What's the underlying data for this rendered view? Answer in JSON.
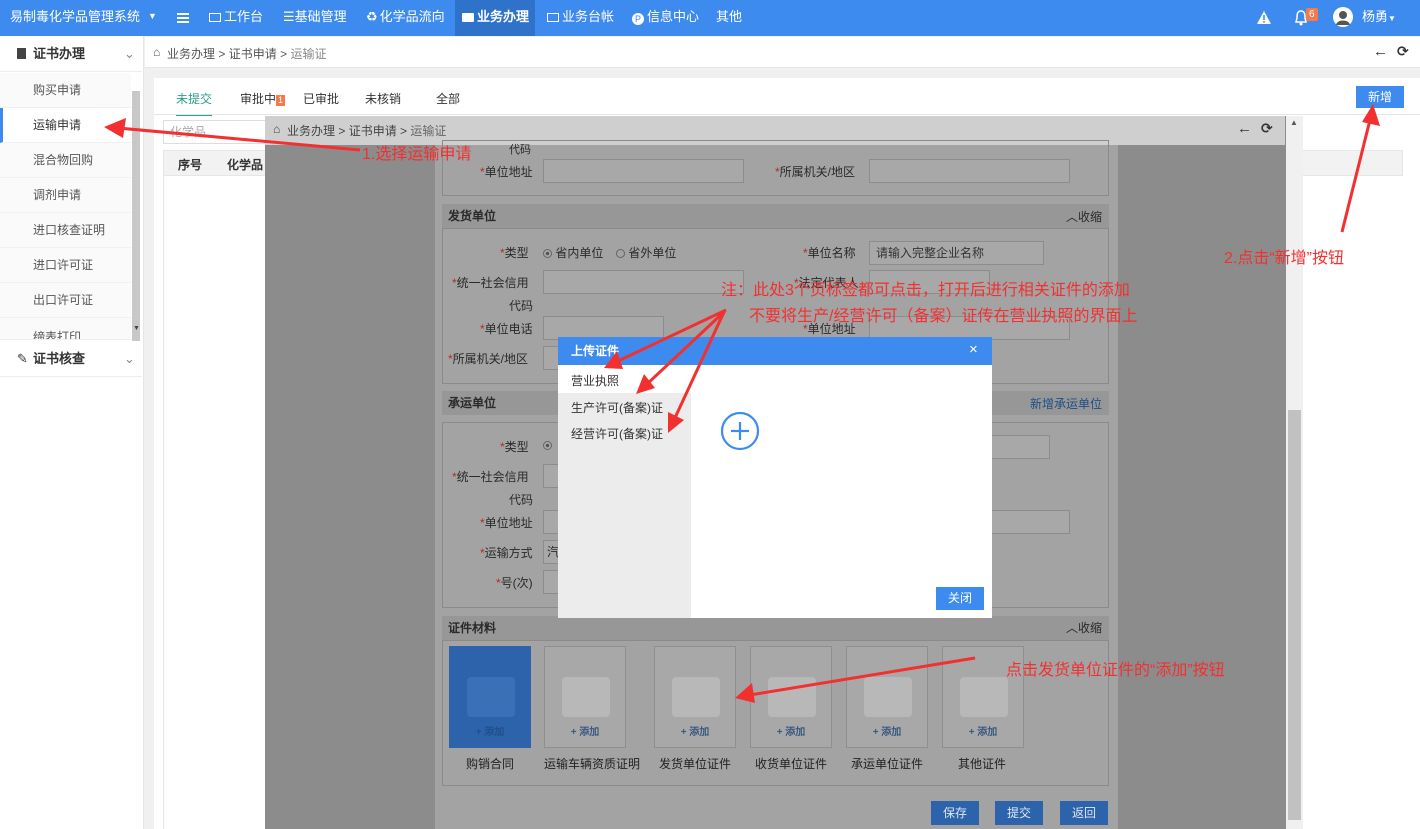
{
  "topbar": {
    "app_title": "易制毒化学品管理系统",
    "nav": [
      "工作台",
      "基础管理",
      "化学品流向",
      "业务办理",
      "业务台帐",
      "信息中心",
      "其他"
    ],
    "active_nav": "业务办理",
    "notif_count": "6",
    "user": "杨勇"
  },
  "sidebar": {
    "sections": [
      {
        "label": "证书办理"
      },
      {
        "label": "证书核查"
      }
    ],
    "items": [
      "购买申请",
      "运输申请",
      "混合物回购",
      "调剂申请",
      "进口核查证明",
      "进口许可证",
      "出口许可证",
      "缔表打印"
    ],
    "active_item": "运输申请"
  },
  "breadcrumb": {
    "home": "业务办理",
    "sep": ">",
    "b2": "证书申请",
    "b3": "运输证"
  },
  "tabs": [
    "未提交",
    "审批中",
    "已审批",
    "未核销",
    "全部"
  ],
  "tab_badge": "1",
  "new_button": "新增",
  "search": {
    "placeholder": "化学品"
  },
  "table": {
    "headers": [
      "序号",
      "化学品"
    ]
  },
  "overlay": {
    "breadcrumb": {
      "home": "业务办理",
      "b2": "证书申请",
      "b3": "运输证"
    },
    "top": {
      "code_tail": "代码",
      "address_label": "单位地址",
      "region_label": "所属机关/地区"
    },
    "shipper": {
      "title": "发货单位",
      "collapse": "收缩",
      "type_label": "类型",
      "opt_in": "省内单位",
      "opt_out": "省外单位",
      "name_label": "单位名称",
      "name_placeholder": "请输入完整企业名称",
      "credit_label": "统一社会信用",
      "credit_label2": "代码",
      "legal_label": "法定代表人",
      "phone_label": "单位电话",
      "address_label": "单位地址",
      "region_label": "所属机关/地区"
    },
    "carrier": {
      "title": "承运单位",
      "add_link": "新增承运单位",
      "type_label": "类型",
      "credit_label": "统一社会信用",
      "credit_label2": "代码",
      "address_label": "单位地址",
      "transport_label": "运输方式",
      "transport_value": "汽",
      "trip_label": "号(次)"
    },
    "materials": {
      "title": "证件材料",
      "collapse": "收缩",
      "add": "+ 添加",
      "cards": [
        "购销合同",
        "运输车辆资质证明",
        "发货单位证件",
        "收货单位证件",
        "承运单位证件",
        "其他证件"
      ]
    },
    "buttons": {
      "save": "保存",
      "submit": "提交",
      "back": "返回"
    }
  },
  "modal": {
    "title": "上传证件",
    "tabs": [
      "营业执照",
      "生产许可(备案)证",
      "经营许可(备案)证"
    ],
    "close_button": "关闭"
  },
  "annotations": {
    "step1": "1.选择运输申请",
    "step2": "2.点击“新增”按钮",
    "note1": "注：此处3个页标签都可点击，打开后进行相关证件的添加",
    "note2": "不要将生产/经营许可（备案）证传在营业执照的界面上",
    "step3": "点击发货单位证件的“添加”按钮"
  }
}
